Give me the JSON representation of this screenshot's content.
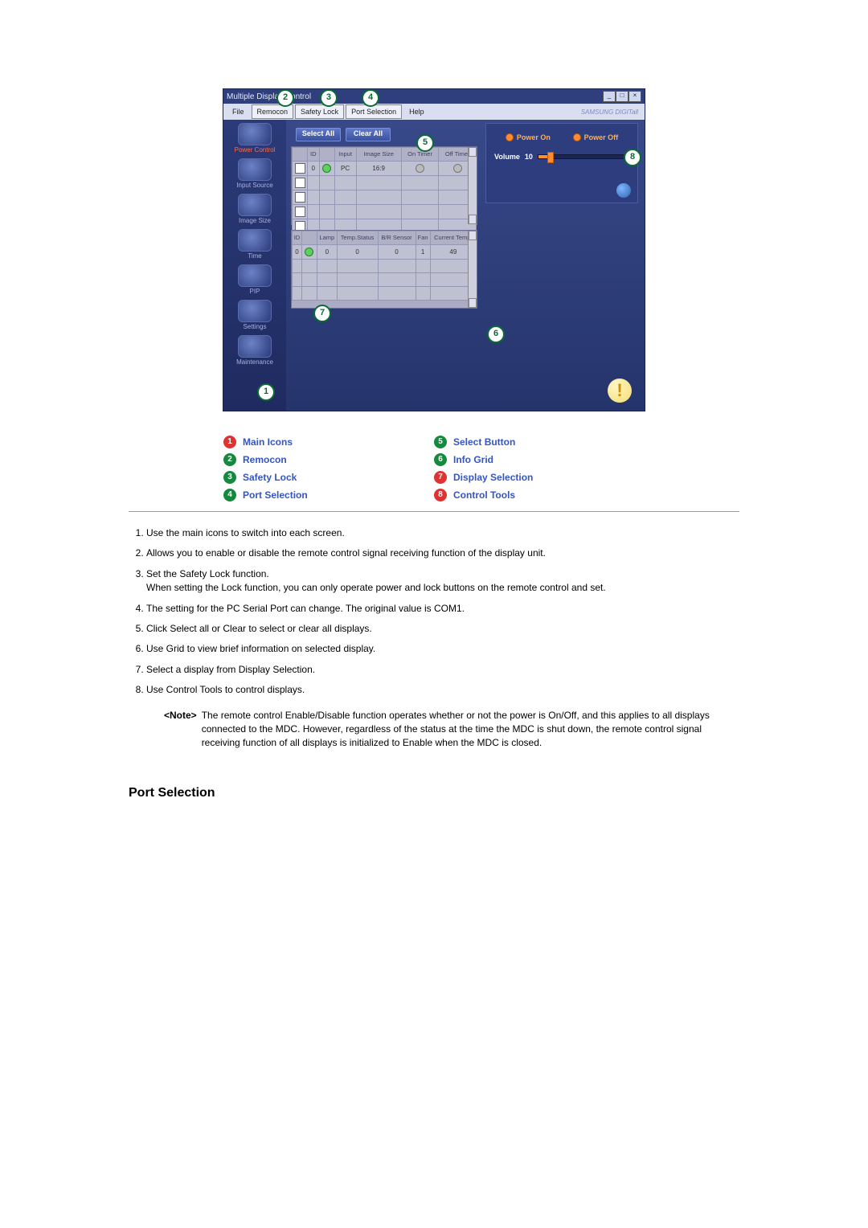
{
  "app": {
    "window_title": "Multiple Display Control",
    "menubar": {
      "file": "File",
      "remocon": "Remocon",
      "safety_lock": "Safety Lock",
      "port_selection": "Port Selection",
      "help": "Help"
    },
    "brand": "SAMSUNG DIGITall",
    "sidebar": [
      {
        "label": "Power Control"
      },
      {
        "label": "Input Source"
      },
      {
        "label": "Image Size"
      },
      {
        "label": "Time"
      },
      {
        "label": "PIP"
      },
      {
        "label": "Settings"
      },
      {
        "label": "Maintenance"
      }
    ],
    "top_buttons": {
      "select_all": "Select All",
      "clear_all": "Clear All"
    },
    "grid1": {
      "headers": [
        "",
        "ID",
        "",
        "Input",
        "Image Size",
        "On Timer",
        "Off Timer"
      ],
      "row": {
        "id": "0",
        "input": "PC",
        "image_size": "16:9"
      }
    },
    "grid2": {
      "headers": [
        "ID",
        "",
        "Lamp",
        "Temp.Status",
        "B/R Sensor",
        "Fan",
        "Current Temp."
      ],
      "row": {
        "id": "0",
        "lamp": "0",
        "temp_status": "0",
        "br_sensor": "0",
        "fan": "1",
        "current_temp": "49"
      }
    },
    "right_panel": {
      "power_on": "Power On",
      "power_off": "Power Off",
      "volume_label": "Volume",
      "volume_value": "10"
    },
    "callouts": {
      "c1": "1",
      "c2": "2",
      "c3": "3",
      "c4": "4",
      "c5": "5",
      "c6": "6",
      "c7": "7",
      "c8": "8"
    }
  },
  "legend": {
    "left": [
      {
        "n": "1",
        "color": "r",
        "label": "Main Icons"
      },
      {
        "n": "2",
        "color": "g",
        "label": "Remocon"
      },
      {
        "n": "3",
        "color": "g",
        "label": "Safety Lock"
      },
      {
        "n": "4",
        "color": "g",
        "label": "Port Selection"
      }
    ],
    "right": [
      {
        "n": "5",
        "color": "g",
        "label": "Select Button"
      },
      {
        "n": "6",
        "color": "g",
        "label": "Info Grid"
      },
      {
        "n": "7",
        "color": "r",
        "label": "Display Selection"
      },
      {
        "n": "8",
        "color": "r",
        "label": "Control Tools"
      }
    ]
  },
  "list": {
    "i1": "Use the main icons to switch into each screen.",
    "i2": "Allows you to enable or disable the remote control signal receiving function of the display unit.",
    "i3a": "Set the Safety Lock function.",
    "i3b": "When setting the Lock function, you can only operate power and lock buttons on the remote control and set.",
    "i4": "The setting for the PC Serial Port can change. The original value is COM1.",
    "i5": "Click Select all or Clear to select or clear all displays.",
    "i6": "Use Grid to view brief information on selected display.",
    "i7": "Select a display from Display Selection.",
    "i8": "Use Control Tools to control displays."
  },
  "note": {
    "label": "<Note>",
    "body": "The remote control Enable/Disable function operates whether or not the power is On/Off, and this applies to all displays connected to the MDC. However, regardless of the status at the time the MDC is shut down, the remote control signal receiving function of all displays is initialized to Enable when the MDC is closed."
  },
  "section_heading": "Port Selection"
}
